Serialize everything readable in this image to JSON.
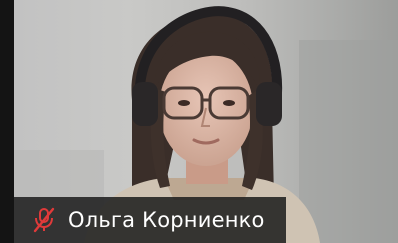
{
  "participant": {
    "name": "Ольга Корниенко",
    "muted": true
  },
  "icons": {
    "mic_status": "muted-mic-icon"
  },
  "colors": {
    "muted_icon": "#e03a3a",
    "name_text": "#ffffff",
    "name_bar": "#1c1c1c",
    "tile_border": "#141414"
  }
}
